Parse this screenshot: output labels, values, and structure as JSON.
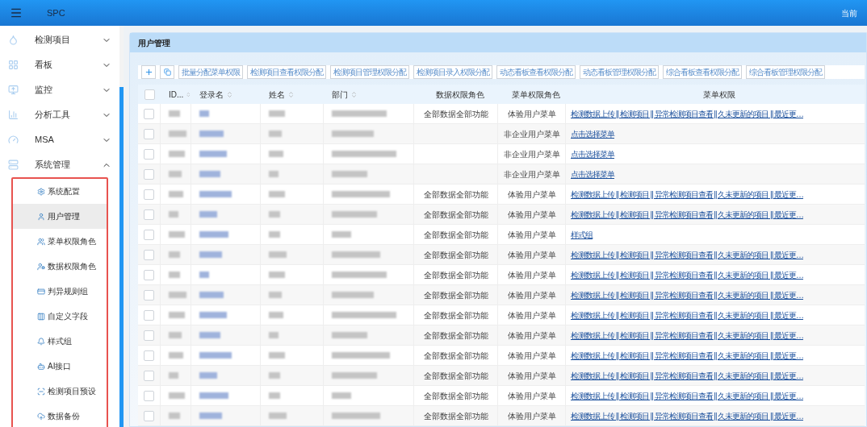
{
  "app_bar": {
    "title": "SPC",
    "user_text": "当前"
  },
  "sidebar": {
    "items": [
      {
        "label": "检测项目",
        "expanded": false
      },
      {
        "label": "看板",
        "expanded": false
      },
      {
        "label": "监控",
        "expanded": false
      },
      {
        "label": "分析工具",
        "expanded": false
      },
      {
        "label": "MSA",
        "expanded": false
      },
      {
        "label": "系统管理",
        "expanded": true,
        "children": [
          {
            "label": "系统配置",
            "selected": false
          },
          {
            "label": "用户管理",
            "selected": true
          },
          {
            "label": "菜单权限角色",
            "selected": false
          },
          {
            "label": "数据权限角色",
            "selected": false
          },
          {
            "label": "判异规则组",
            "selected": false
          },
          {
            "label": "自定义字段",
            "selected": false
          },
          {
            "label": "样式组",
            "selected": false
          },
          {
            "label": "AI接口",
            "selected": false
          },
          {
            "label": "检测项目预设",
            "selected": false
          },
          {
            "label": "数据备份",
            "selected": false
          }
        ]
      }
    ]
  },
  "panel": {
    "title": "用户管理",
    "toolbar": [
      "批量分配菜单权限",
      "检测项目查看权限分配",
      "检测项目管理权限分配",
      "检测项目录入权限分配",
      "动态看板查看权限分配",
      "动态看板管理权限分配",
      "综合看板查看权限分配",
      "综合看板管理权限分配"
    ],
    "table": {
      "select_all_checked": false,
      "columns": [
        {
          "label": "ID...",
          "sortable": true
        },
        {
          "label": "登录名",
          "sortable": true
        },
        {
          "label": "姓名",
          "sortable": true
        },
        {
          "label": "部门",
          "sortable": true
        },
        {
          "label": "数据权限角色",
          "sortable": false
        },
        {
          "label": "菜单权限角色",
          "sortable": false
        },
        {
          "label": "菜单权限",
          "sortable": false
        }
      ],
      "rows": [
        {
          "checked": false,
          "data_role": "全部数据全部功能",
          "menu_role": "体验用户菜单",
          "menu_permission": "检测数据上传 || 检测项目 || 异常检测项目查看 || 久未更新的项目 || 最近更…"
        },
        {
          "checked": false,
          "menu_role": "非企业用户菜单",
          "menu_permission": "点击选择菜单"
        },
        {
          "checked": false,
          "menu_role": "非企业用户菜单",
          "menu_permission": "点击选择菜单"
        },
        {
          "checked": false,
          "menu_role": "非企业用户菜单",
          "menu_permission": "点击选择菜单"
        },
        {
          "checked": false,
          "data_role": "全部数据全部功能",
          "menu_role": "体验用户菜单",
          "menu_permission": "检测数据上传 || 检测项目 || 异常检测项目查看 || 久未更新的项目 || 最近更…"
        },
        {
          "checked": false,
          "data_role": "全部数据全部功能",
          "menu_role": "体验用户菜单",
          "menu_permission": "检测数据上传 || 检测项目 || 异常检测项目查看 || 久未更新的项目 || 最近更…"
        },
        {
          "checked": false,
          "data_role": "全部数据全部功能",
          "menu_role": "体验用户菜单",
          "menu_permission": "样式组"
        },
        {
          "checked": false,
          "data_role": "全部数据全部功能",
          "menu_role": "体验用户菜单",
          "menu_permission": "检测数据上传 || 检测项目 || 异常检测项目查看 || 久未更新的项目 || 最近更…"
        },
        {
          "checked": false,
          "data_role": "全部数据全部功能",
          "menu_role": "体验用户菜单",
          "menu_permission": "检测数据上传 || 检测项目 || 异常检测项目查看 || 久未更新的项目 || 最近更…"
        },
        {
          "checked": false,
          "data_role": "全部数据全部功能",
          "menu_role": "体验用户菜单",
          "menu_permission": "检测数据上传 || 检测项目 || 异常检测项目查看 || 久未更新的项目 || 最近更…"
        },
        {
          "checked": false,
          "data_role": "全部数据全部功能",
          "menu_role": "体验用户菜单",
          "menu_permission": "检测数据上传 || 检测项目 || 异常检测项目查看 || 久未更新的项目 || 最近更…"
        },
        {
          "checked": false,
          "data_role": "全部数据全部功能",
          "menu_role": "体验用户菜单",
          "menu_permission": "检测数据上传 || 检测项目 || 异常检测项目查看 || 久未更新的项目 || 最近更…"
        },
        {
          "checked": false,
          "data_role": "全部数据全部功能",
          "menu_role": "体验用户菜单",
          "menu_permission": "检测数据上传 || 检测项目 || 异常检测项目查看 || 久未更新的项目 || 最近更…"
        },
        {
          "checked": false,
          "data_role": "全部数据全部功能",
          "menu_role": "体验用户菜单",
          "menu_permission": "检测数据上传 || 检测项目 || 异常检测项目查看 || 久未更新的项目 || 最近更…"
        },
        {
          "checked": false,
          "data_role": "全部数据全部功能",
          "menu_role": "体验用户菜单",
          "menu_permission": "检测数据上传 || 检测项目 || 异常检测项目查看 || 久未更新的项目 || 最近更…"
        },
        {
          "checked": false,
          "data_role": "全部数据全部功能",
          "menu_role": "体验用户菜单",
          "menu_permission": "检测数据上传 || 检测项目 || 异常检测项目查看 || 久未更新的项目 || 最近更…"
        }
      ]
    }
  }
}
